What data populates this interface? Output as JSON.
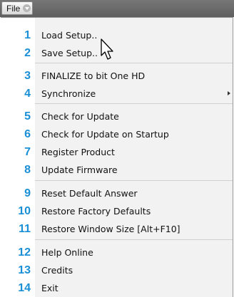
{
  "menu_button": {
    "label": "File"
  },
  "items": [
    {
      "num": "1",
      "label": "Load Setup.."
    },
    {
      "num": "2",
      "label": "Save Setup.."
    },
    {
      "num": "3",
      "label": "FINALIZE to bit One HD"
    },
    {
      "num": "4",
      "label": "Synchronize",
      "submenu": true
    },
    {
      "num": "5",
      "label": "Check for Update"
    },
    {
      "num": "6",
      "label": "Check for Update on Startup"
    },
    {
      "num": "7",
      "label": "Register Product"
    },
    {
      "num": "8",
      "label": "Update Firmware"
    },
    {
      "num": "9",
      "label": "Reset Default Answer"
    },
    {
      "num": "10",
      "label": "Restore Factory Defaults"
    },
    {
      "num": "11",
      "label": "Restore Window Size [Alt+F10]"
    },
    {
      "num": "12",
      "label": "Help Online"
    },
    {
      "num": "13",
      "label": "Credits"
    },
    {
      "num": "14",
      "label": "Exit"
    }
  ],
  "colors": {
    "number": "#1a8fd6",
    "menu_bg": "#f2f2f2",
    "topbar": "#666666"
  }
}
